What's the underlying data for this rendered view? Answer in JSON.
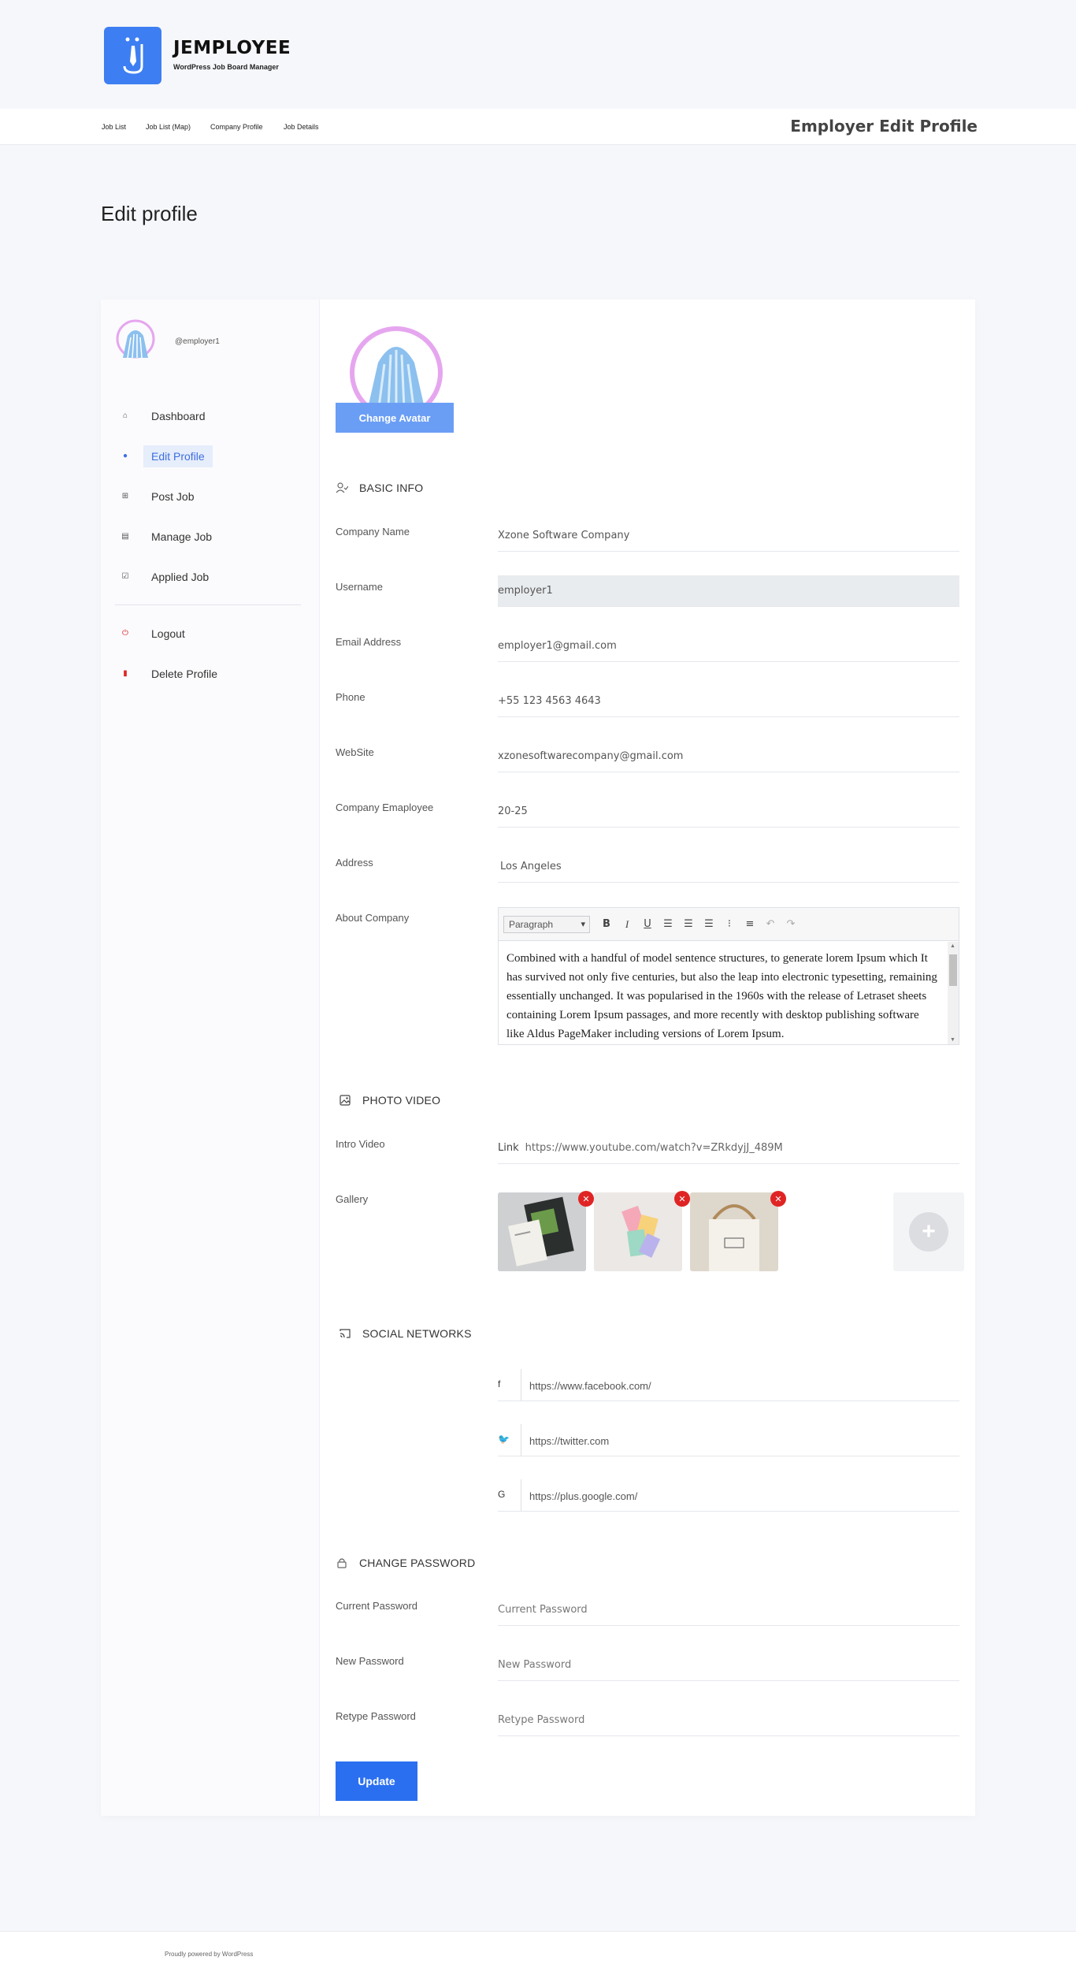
{
  "brand": {
    "title": "JEMPLOYEE",
    "subtitle": "WordPress Job Board Manager",
    "logo_icon": "tie-person-icon",
    "accent": "#3d7ff2"
  },
  "nav": {
    "links": [
      "Job List",
      "Job List (Map)",
      "Company Profile",
      "Job Details"
    ],
    "page_title": "Employer Edit Profile"
  },
  "page_heading": "Edit profile",
  "sidebar": {
    "username": "@employer1",
    "items": [
      {
        "label": "Dashboard",
        "icon": "home-icon"
      },
      {
        "label": "Edit Profile",
        "icon": "user-icon",
        "active": true
      },
      {
        "label": "Post Job",
        "icon": "plus-square-icon"
      },
      {
        "label": "Manage Job",
        "icon": "briefcase-icon"
      },
      {
        "label": "Applied Job",
        "icon": "check-square-icon"
      },
      {
        "label": "Logout",
        "icon": "power-icon"
      },
      {
        "label": "Delete Profile",
        "icon": "trash-icon"
      }
    ]
  },
  "avatar": {
    "change_label": "Change Avatar"
  },
  "basic_info": {
    "title": "BASIC INFO",
    "fields": [
      {
        "label": "Company Name",
        "value": "Xzone Software Company"
      },
      {
        "label": "Username",
        "value": "employer1"
      },
      {
        "label": "Email Address",
        "value": "employer1@gmail.com"
      },
      {
        "label": "Phone",
        "value": "+55 123 4563 4643"
      },
      {
        "label": "WebSite",
        "value": "xzonesoftwarecompany@gmail.com"
      },
      {
        "label": "Company Emaployee",
        "value": "20-25"
      },
      {
        "label": "Address",
        "value": "Los Angeles"
      },
      {
        "label": "About Company"
      }
    ],
    "editor": {
      "format": "Paragraph",
      "text": "Combined with a handful of model sentence structures, to generate lorem Ipsum which It has survived not only five centuries, but also the leap into electronic typesetting, remaining essentially unchanged. It was popularised in the 1960s with the release of Letraset sheets containing Lorem Ipsum passages, and more recently with desktop publishing software like Aldus PageMaker including versions of Lorem Ipsum."
    }
  },
  "photo_video": {
    "title": "PHOTO VIDEO",
    "intro_label": "Intro Video",
    "link_prefix": "Link",
    "intro_value": "https://www.youtube.com/watch?v=ZRkdyjJ_489M",
    "gallery_label": "Gallery"
  },
  "social": {
    "title": "SOCIAL NETWORKS",
    "items": [
      {
        "icon": "facebook-icon",
        "value": "https://www.facebook.com/"
      },
      {
        "icon": "twitter-icon",
        "value": "https://twitter.com"
      },
      {
        "icon": "google-plus-icon",
        "value": "https://plus.google.com/"
      }
    ]
  },
  "password": {
    "title": "CHANGE PASSWORD",
    "fields": [
      {
        "label": "Current Password",
        "placeholder": "Current Password"
      },
      {
        "label": "New Password",
        "placeholder": "New Password"
      },
      {
        "label": "Retype Password",
        "placeholder": "Retype Password"
      }
    ]
  },
  "update_label": "Update",
  "footer": "Proudly powered by WordPress"
}
